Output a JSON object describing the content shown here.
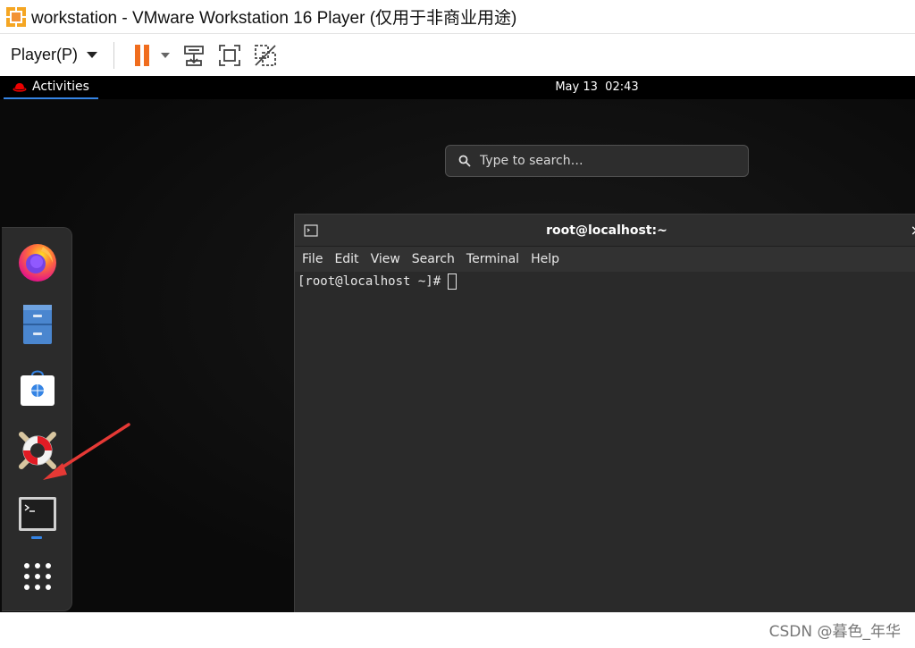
{
  "window": {
    "title": "workstation - VMware Workstation 16 Player (仅用于非商业用途)"
  },
  "toolbar": {
    "player_menu_label": "Player(P)",
    "icons": [
      "pause-icon",
      "send-ctrl-alt-del-icon",
      "fullscreen-icon",
      "unity-icon"
    ]
  },
  "guest": {
    "topbar": {
      "activities_label": "Activities",
      "clock_date": "May 13",
      "clock_time": "02:43"
    },
    "search": {
      "placeholder": "Type to search…"
    },
    "dash": {
      "items": [
        "firefox",
        "files",
        "software",
        "help",
        "terminal",
        "show-applications"
      ]
    },
    "terminal": {
      "title": "root@localhost:~",
      "menu": [
        "File",
        "Edit",
        "View",
        "Search",
        "Terminal",
        "Help"
      ],
      "prompt": "[root@localhost ~]#"
    }
  },
  "watermark": "CSDN @暮色_年华",
  "colors": {
    "pause": "#f06d1e",
    "activities_underline": "#3584e4",
    "annotation_arrow": "#e53935"
  }
}
